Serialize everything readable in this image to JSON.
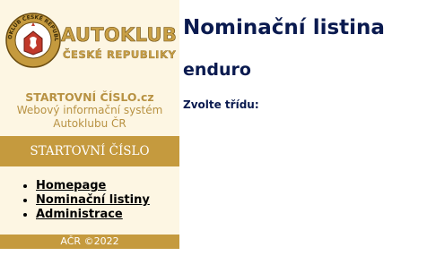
{
  "logo": {
    "emblem_text": "AUTOKLUB ČESKÉ REPUBLIKY",
    "title": "AUTOKLUB",
    "subtitle": "ČESKÉ REPUBLIKY"
  },
  "sidebar": {
    "site_name": "STARTOVNÍ ČÍSLO.cz",
    "description_line1": "Webový informační systém",
    "description_line2": "Autoklubu ČR",
    "section_title": "STARTOVNÍ ČÍSLO",
    "nav_items": [
      {
        "label": "Homepage"
      },
      {
        "label": "Nominační listiny"
      },
      {
        "label": "Administrace"
      }
    ],
    "footer": "AČR ©2022"
  },
  "main": {
    "title": "Nominační listina",
    "subtitle": "enduro",
    "prompt": "Zvolte třídu:"
  },
  "colors": {
    "sidebar_bg": "#fdf6e3",
    "accent_gold": "#c59a3e",
    "heading_navy": "#0a1a4f",
    "logo_red": "#c0392b"
  }
}
